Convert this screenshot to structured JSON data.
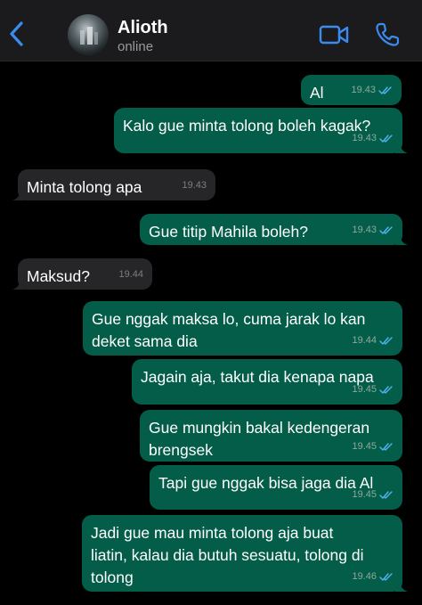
{
  "header": {
    "name": "Alioth",
    "status": "online",
    "icons": {
      "back": "chevron-left-icon",
      "video": "video-camera-icon",
      "call": "phone-icon"
    },
    "accent_color": "#3a8cf0"
  },
  "colors": {
    "outgoing_bubble": "#045d48",
    "incoming_bubble": "#262628",
    "read_ticks": "#4fb5ef"
  },
  "messages": [
    {
      "direction": "out",
      "lines": [
        "Al"
      ],
      "time": "19.43",
      "read": true
    },
    {
      "direction": "out",
      "lines": [
        "Kalo gue minta tolong boleh kagak?"
      ],
      "time": "19.43",
      "read": true
    },
    {
      "direction": "in",
      "lines": [
        "Minta tolong apa"
      ],
      "time": "19.43"
    },
    {
      "direction": "out",
      "lines": [
        "Gue titip Mahila boleh?"
      ],
      "time": "19.43",
      "read": true
    },
    {
      "direction": "in",
      "lines": [
        "Maksud?"
      ],
      "time": "19.44"
    },
    {
      "direction": "out",
      "lines": [
        "Gue nggak maksa lo, cuma jarak lo kan",
        "deket sama dia"
      ],
      "time": "19.44",
      "read": true
    },
    {
      "direction": "out",
      "lines": [
        "Jagain aja, takut dia kenapa napa"
      ],
      "time": "19.45",
      "read": true
    },
    {
      "direction": "out",
      "lines": [
        "Gue mungkin bakal kedengeran",
        "brengsek"
      ],
      "time": "19.45",
      "read": true
    },
    {
      "direction": "out",
      "lines": [
        "Tapi gue nggak bisa jaga dia Al"
      ],
      "time": "19.45",
      "read": true
    },
    {
      "direction": "out",
      "lines": [
        "Jadi gue mau minta tolong aja buat",
        "liatin, kalau dia butuh sesuatu, tolong di",
        "tolong"
      ],
      "time": "19.46",
      "read": true
    }
  ]
}
